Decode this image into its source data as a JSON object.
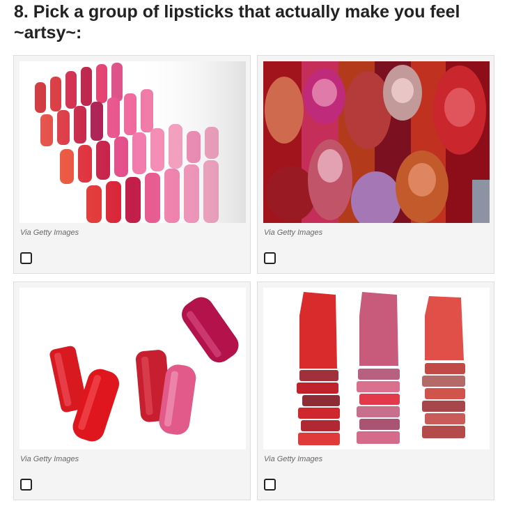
{
  "quiz": {
    "question": "8. Pick a group of lipsticks that actually make you feel ~artsy~:"
  },
  "options": [
    {
      "credit": "Via Getty Images",
      "image_desc": "diagonal rows of red and pink lipsticks",
      "checked": false
    },
    {
      "credit": "Via Getty Images",
      "image_desc": "close-up of red, magenta and purple lipstick tips",
      "checked": false
    },
    {
      "credit": "Via Getty Images",
      "image_desc": "five scattered red and pink lipstick bullets",
      "checked": false
    },
    {
      "credit": "Via Getty Images",
      "image_desc": "three sliced lipsticks stacked in segments",
      "checked": false
    }
  ],
  "colors": {
    "card_bg": "#f4f4f4",
    "border": "#dddddd",
    "title_text": "#222222",
    "credit_text": "#666666"
  }
}
